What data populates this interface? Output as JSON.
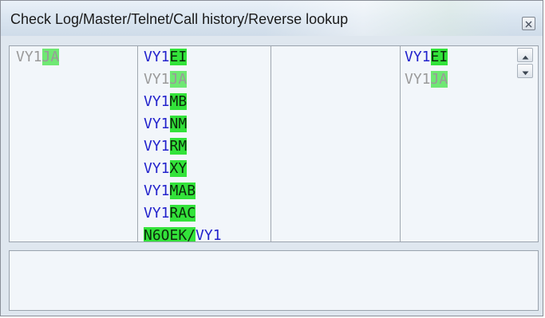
{
  "window": {
    "title": "Check Log/Master/Telnet/Call history/Reverse lookup",
    "close_icon": "close-icon"
  },
  "columns": {
    "check_log": [
      {
        "prefix": "VY1",
        "suffix": "JA",
        "dim": true
      }
    ],
    "master": [
      {
        "prefix": "VY1",
        "suffix": "EI",
        "dim": false
      },
      {
        "prefix": "VY1",
        "suffix": "JA",
        "dim": true
      },
      {
        "prefix": "VY1",
        "suffix": "MB",
        "dim": false
      },
      {
        "prefix": "VY1",
        "suffix": "NM",
        "dim": false
      },
      {
        "prefix": "VY1",
        "suffix": "RM",
        "dim": false
      },
      {
        "prefix": "VY1",
        "suffix": "XY",
        "dim": false
      },
      {
        "prefix": "VY1",
        "suffix": "MAB",
        "dim": false
      },
      {
        "prefix": "VY1",
        "suffix": "RAC",
        "dim": false
      },
      {
        "prefix": "",
        "suffix": "N6OEK/",
        "tail": "VY1",
        "dim": false
      }
    ],
    "telnet": [],
    "reverse_lookup": [
      {
        "prefix": "VY1",
        "suffix": "EI",
        "dim": false
      },
      {
        "prefix": "VY1",
        "suffix": "JA",
        "dim": true
      }
    ]
  },
  "scrollbar": {
    "up_icon": "scroll-up-arrow-icon",
    "down_icon": "scroll-down-arrow-icon"
  },
  "call_history": {
    "text": ""
  },
  "colors": {
    "prefix": "#2323cc",
    "dim_text": "#9a9a9a",
    "highlight": "#33e33a"
  }
}
